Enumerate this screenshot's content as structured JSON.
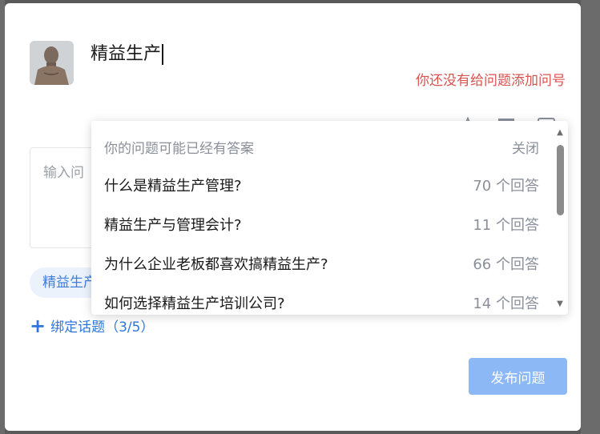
{
  "question": {
    "title_value": "精益生产",
    "warning": "你还没有给问题添加问号"
  },
  "editor": {
    "placeholder": "输入问"
  },
  "topic_chip": "精益生产",
  "bind_topic": {
    "label": "绑定话题（3/5）"
  },
  "publish_button": "发布问题",
  "suggestions": {
    "header": "你的问题可能已经有答案",
    "close": "关闭",
    "items": [
      {
        "title": "什么是精益生产管理?",
        "count": "70 个回答"
      },
      {
        "title": "精益生产与管理会计?",
        "count": "11 个回答"
      },
      {
        "title": "为什么企业老板都喜欢搞精益生产?",
        "count": "66 个回答"
      },
      {
        "title": "如何选择精益生产培训公司?",
        "count": "14 个回答"
      }
    ]
  },
  "icons": {
    "toolbar": [
      "font-icon",
      "image-icon",
      "emoji-icon"
    ]
  },
  "colors": {
    "primary": "#2f76db",
    "warning": "#d9534f",
    "publish_disabled": "#8cb8f5"
  }
}
